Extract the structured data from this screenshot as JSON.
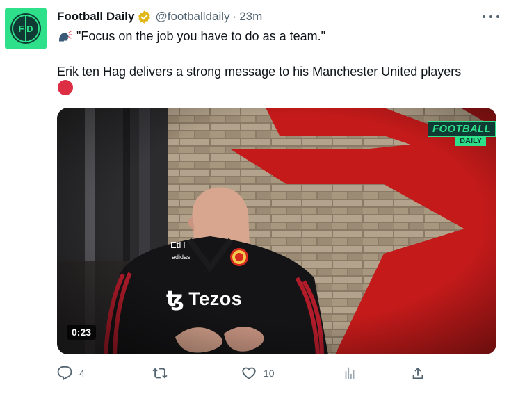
{
  "tweet": {
    "author_name": "Football Daily",
    "handle": "@footballdaily",
    "separator": "·",
    "time": "23m",
    "line1": "\"Focus on the job you have to do as a team.\"",
    "line2": "Erik ten Hag delivers a strong message to his Manchester United players",
    "avatar_text": "F D"
  },
  "video": {
    "badge_top": "FOOTBALL",
    "badge_bottom": "DAILY",
    "duration": "0:23",
    "shirt_initials": "EtH",
    "shirt_brand": "adidas",
    "sponsor": "Tezos"
  },
  "actions": {
    "replies": "4",
    "reposts": "",
    "likes": "10",
    "views": ""
  },
  "colors": {
    "brand_green": "#2fe08a",
    "verified_gold": "#e2b719",
    "secondary_text": "#536471"
  },
  "icons": [
    "more-icon",
    "verified-badge-icon",
    "speaking-head-icon",
    "red-circle-icon",
    "reply-icon",
    "repost-icon",
    "like-icon",
    "views-icon",
    "share-icon"
  ]
}
